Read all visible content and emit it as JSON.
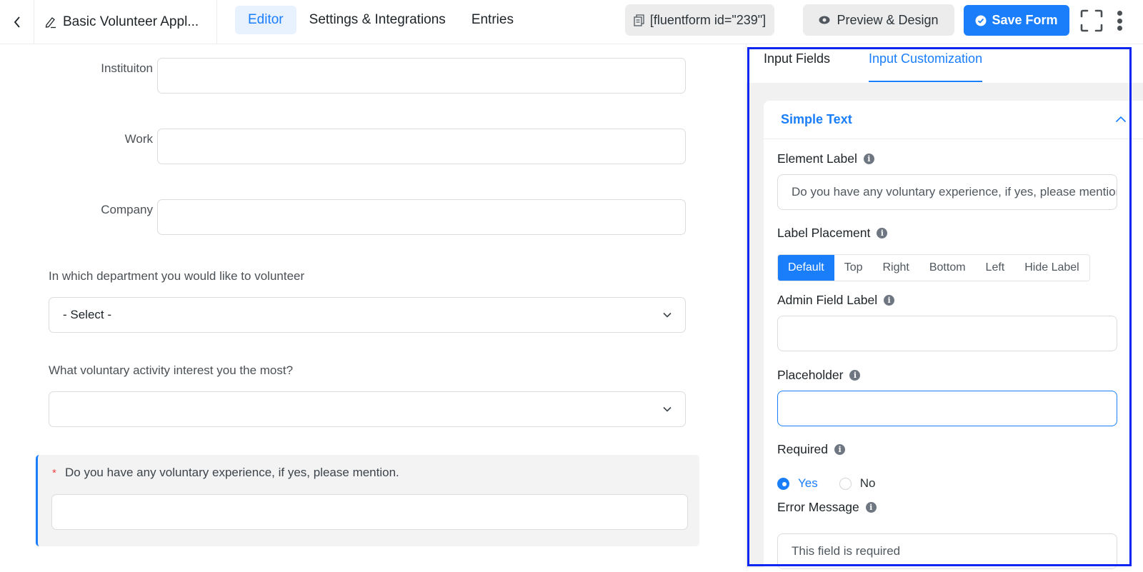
{
  "header": {
    "back_icon": "chevron-left-icon",
    "form_title": "Basic Volunteer Appl...",
    "title_icon": "pencil-icon",
    "nav_tabs": [
      {
        "label": "Editor",
        "active": true
      },
      {
        "label": "Settings & Integrations",
        "active": false
      },
      {
        "label": "Entries",
        "active": false
      }
    ],
    "shortcode_label": "[fluentform id=\"239\"]",
    "shortcode_icon": "copy-icon",
    "preview_label": "Preview & Design",
    "preview_icon": "eye-icon",
    "save_label": "Save Form",
    "save_icon": "check-circle-icon",
    "fullscreen_icon": "fullscreen-icon",
    "more_icon": "more-vertical-icon"
  },
  "form": {
    "inline_fields": [
      {
        "label": "Instituiton",
        "value": ""
      },
      {
        "label": "Work",
        "value": ""
      },
      {
        "label": "Company",
        "value": ""
      }
    ],
    "selects": [
      {
        "label": "In which department you would like to volunteer",
        "value": "- Select -"
      },
      {
        "label": "What voluntary activity interest you the most?",
        "value": ""
      }
    ],
    "selected_field": {
      "required_mark": "*",
      "label": "Do you have any voluntary experience, if yes, please mention.",
      "value": ""
    }
  },
  "panel": {
    "tabs": [
      {
        "label": "Input Fields",
        "active": false
      },
      {
        "label": "Input Customization",
        "active": true
      }
    ],
    "section_title": "Simple Text",
    "section_expanded": true,
    "element_label": {
      "label": "Element Label",
      "value": "Do you have any voluntary experience, if yes, please mention."
    },
    "label_placement": {
      "label": "Label Placement",
      "options": [
        "Default",
        "Top",
        "Right",
        "Bottom",
        "Left",
        "Hide Label"
      ],
      "selected": "Default"
    },
    "admin_field_label": {
      "label": "Admin Field Label",
      "value": ""
    },
    "placeholder": {
      "label": "Placeholder",
      "value": ""
    },
    "required": {
      "label": "Required",
      "options": [
        "Yes",
        "No"
      ],
      "selected": "Yes"
    },
    "error_message": {
      "label": "Error Message",
      "value": "This field is required"
    }
  },
  "colors": {
    "accent": "#1a7efb",
    "highlight_border": "#0a26f0",
    "required_star": "#f04141"
  }
}
